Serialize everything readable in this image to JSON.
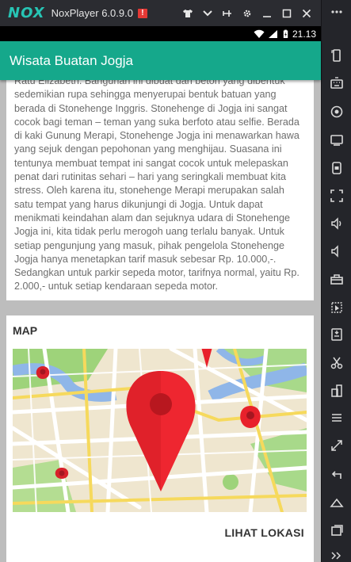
{
  "emulator": {
    "logo": "NOX",
    "title": "NoxPlayer 6.0.9.0",
    "badge": "!"
  },
  "statusbar": {
    "time": "21.13"
  },
  "app": {
    "title": "Wisata Buatan Jogja"
  },
  "description": "Ratu Elizabeth. Bangunan ini dibuat dari beton yang dibentuk sedemikian rupa sehingga menyerupai bentuk batuan yang berada di Stonehenge Inggris. Stonehenge di Jogja ini sangat cocok bagi teman – teman yang suka berfoto atau selfie. Berada di kaki Gunung Merapi, Stonehenge Jogja ini menawarkan hawa yang sejuk dengan pepohonan yang menghijau. Suasana ini tentunya membuat tempat ini sangat cocok untuk melepaskan penat dari rutinitas sehari – hari yang seringkali membuat kita stress. Oleh karena itu, stonehenge Merapi merupakan salah satu tempat yang harus dikunjungi di Jogja. Untuk dapat menikmati keindahan alam dan sejuknya udara di Stonehenge Jogja ini, kita tidak perlu merogoh uang terlalu banyak. Untuk setiap pengunjung yang masuk, pihak pengelola Stonehenge Jogja hanya menetapkan tarif masuk sebesar Rp. 10.000,-. Sedangkan untuk parkir sepeda motor, tarifnya normal, yaitu Rp. 2.000,- untuk setiap kendaraan sepeda motor.",
  "map_card": {
    "title": "MAP",
    "button": "LIHAT LOKASI"
  },
  "colors": {
    "accent": "#15a88b",
    "titlebar": "#2b2c31",
    "sidebar": "#24252a",
    "pin": "#e8212b"
  }
}
